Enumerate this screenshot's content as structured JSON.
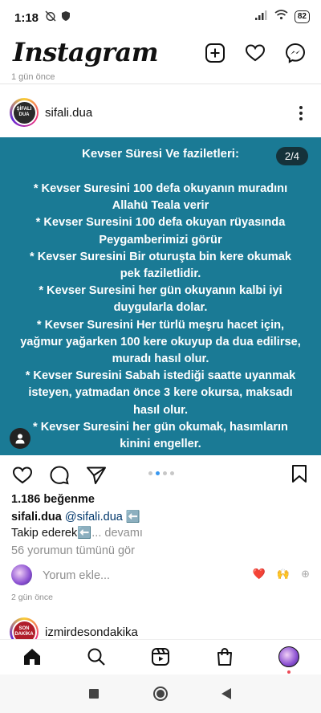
{
  "status_bar": {
    "time": "1:18",
    "battery": "82"
  },
  "header": {
    "app_name": "Instagram"
  },
  "prev_post": {
    "time": "1 gün önce"
  },
  "post": {
    "username": "sifali.dua",
    "avatar_text": "ŞİFALI DUA",
    "page_counter": "2/4",
    "image_title": "Kevser Süresi Ve faziletleri:",
    "image_lines": [
      "* Kevser Suresini 100 defa okuyanın muradını",
      "Allahü Teala verir",
      "* Kevser Suresini 100 defa okuyan rüyasında",
      "Peygamberimizi görür",
      "* Kevser Suresini Bir oturuşta bin kere okumak",
      "pek faziletlidir.",
      "* Kevser Suresini her gün okuyanın kalbi iyi",
      "duygularla dolar.",
      "* Kevser Suresini Her türlü meşru hacet için,",
      "yağmur yağarken 100 kere okuyup da dua edilirse,",
      "muradı hasıl olur.",
      "* Kevser Suresini Sabah istediği saatte uyanmak",
      "isteyen, yatmadan önce 3 kere okursa, maksadı",
      "hasıl olur.",
      "* Kevser Suresini her gün okumak, hasımların",
      "kinini engeller."
    ],
    "carousel": {
      "count": 4,
      "active_index": 1
    },
    "likes": "1.186 beğenme",
    "caption": {
      "username": "sifali.dua",
      "mention": "@sifali.dua",
      "arrow": "⬅️",
      "line2_text": "Takip ederek⬅️",
      "line2_more": "... devamı"
    },
    "view_comments": "56 yorumun tümünü gör",
    "comment_placeholder": "Yorum ekle...",
    "quick_emojis": [
      "❤️",
      "🙌",
      "⊕"
    ],
    "time": "2 gün önce"
  },
  "next_post": {
    "username": "izmirdesondakika",
    "avatar_text": "SON DAKİKA"
  },
  "bottom_nav": [
    "home-icon",
    "search-icon",
    "reels-icon",
    "shop-icon",
    "profile-avatar"
  ],
  "colors": {
    "post_background": "#1a7a95",
    "accent_blue": "#3897f0",
    "like_red": "#ed4956"
  }
}
